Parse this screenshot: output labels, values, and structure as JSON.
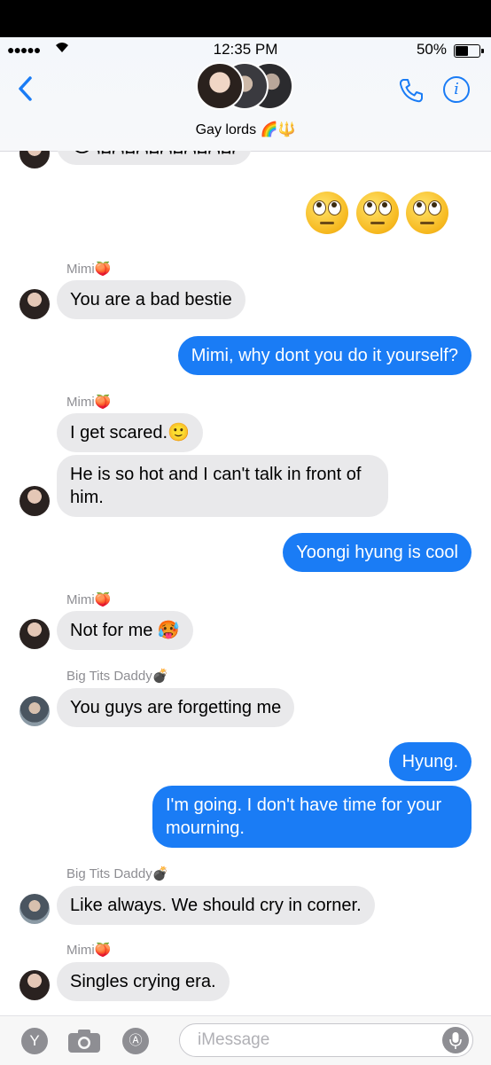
{
  "status": {
    "time": "12:35 PM",
    "battery": "50%",
    "battery_level": 0.5
  },
  "header": {
    "group_name": "Gay lords 🌈🔱"
  },
  "messages": [
    {
      "from": "Mimi🍑",
      "text": "You are a bad bestie"
    },
    {
      "text": "Mimi, why dont you do it yourself?"
    },
    {
      "from": "Mimi🍑",
      "text": "I get scared.🙂"
    },
    {
      "text": "He is so hot and I can't talk in front of him."
    },
    {
      "text": "Yoongi hyung is cool"
    },
    {
      "from": "Mimi🍑",
      "text": "Not for me 🥵"
    },
    {
      "from": "Big Tits Daddy💣",
      "text": "You guys are forgetting me"
    },
    {
      "text": "Hyung."
    },
    {
      "text": "I'm going. I don't have time for your mourning."
    },
    {
      "from": "Big Tits Daddy💣",
      "text": "Like always. We should cry in corner."
    },
    {
      "from": "Mimi🍑",
      "text": "Singles crying era."
    }
  ],
  "top_partial": "😊😱😱😱😱😱😱",
  "input": {
    "placeholder": "iMessage"
  },
  "accent": "#1a7cf5"
}
